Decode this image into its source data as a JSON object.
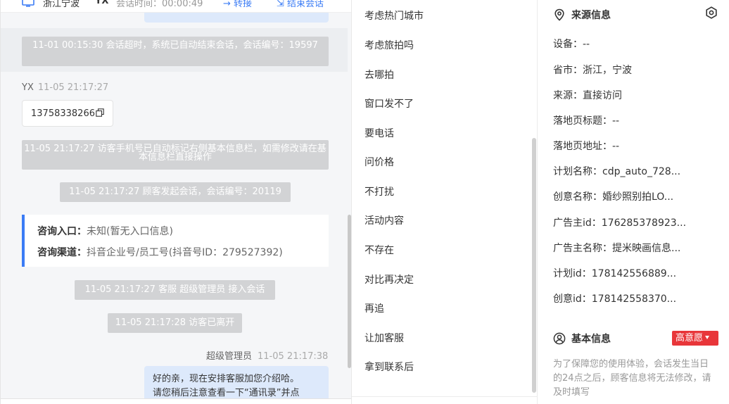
{
  "chat": {
    "header": {
      "location": "浙江宁波",
      "visitor": "YX",
      "duration": "会话时间：00:00:49",
      "transfer_label": "转接",
      "end_label": "结束会话"
    },
    "system_msgs": [
      "11-01 00:15:30 会话超时，系统已自动结束会话，会话编号：19597",
      "11-05 21:17:27 访客手机号已自动标记右侧基本信息栏，如需修改请在基本信息栏直接操作",
      "11-05 21:17:27 顾客发起会话，会话编号：20119",
      "11-05 21:17:27 客服 超级管理员 接入会话",
      "11-05 21:17:28 访客已离开"
    ],
    "visitor_name": "YX",
    "visitor_time": "11-05 21:17:27",
    "phone": "13758338266",
    "consult": {
      "entry_label": "咨询入口：",
      "entry_value": "未知(暂无入口信息)",
      "channel_label": "咨询渠道：",
      "channel_value": "抖音企业号/员工号(抖音号ID：279527392)"
    },
    "agent_name": "超级管理员",
    "agent_time": "11-05 21:17:38",
    "agent_line1": "好的亲，现在安排客服加您介绍哈。",
    "agent_line2": "请您稍后注意查看一下“通讯录”并点"
  },
  "quick_replies": [
    "考虑热门城市",
    "考虑旅拍吗",
    "去哪拍",
    "窗口发不了",
    "要电话",
    "问价格",
    "不打扰",
    "活动内容",
    "不存在",
    "对比再决定",
    "再追",
    "让加客服",
    "拿到联系后"
  ],
  "source": {
    "title": "来源信息",
    "device": "设备：--",
    "province": "省市：浙江，宁波",
    "origin": "来源：直接访问",
    "landing_title": "落地页标题：--",
    "landing_url": "落地页地址：--",
    "plan_name": "计划名称：cdp_auto_728...",
    "creative_name": "创意名称：婚纱照别拍LO...",
    "advertiser_id": "广告主id：176285378923...",
    "advertiser_name": "广告主名称：提米映画信息...",
    "plan_id": "计划id：178142556889...",
    "creative_id": "创意id：178142558370..."
  },
  "basic": {
    "title": "基本信息",
    "intent_badge": "高意愿",
    "note": "为了保障您的使用体验，会话发生当日的24点之后，顾客信息将无法修改，请及时填写"
  },
  "colors": {
    "accent": "#3b7cf5",
    "badge": "#e8363a",
    "agent_bubble": "#dde9fb",
    "system_msg": "#d2d3d5"
  }
}
